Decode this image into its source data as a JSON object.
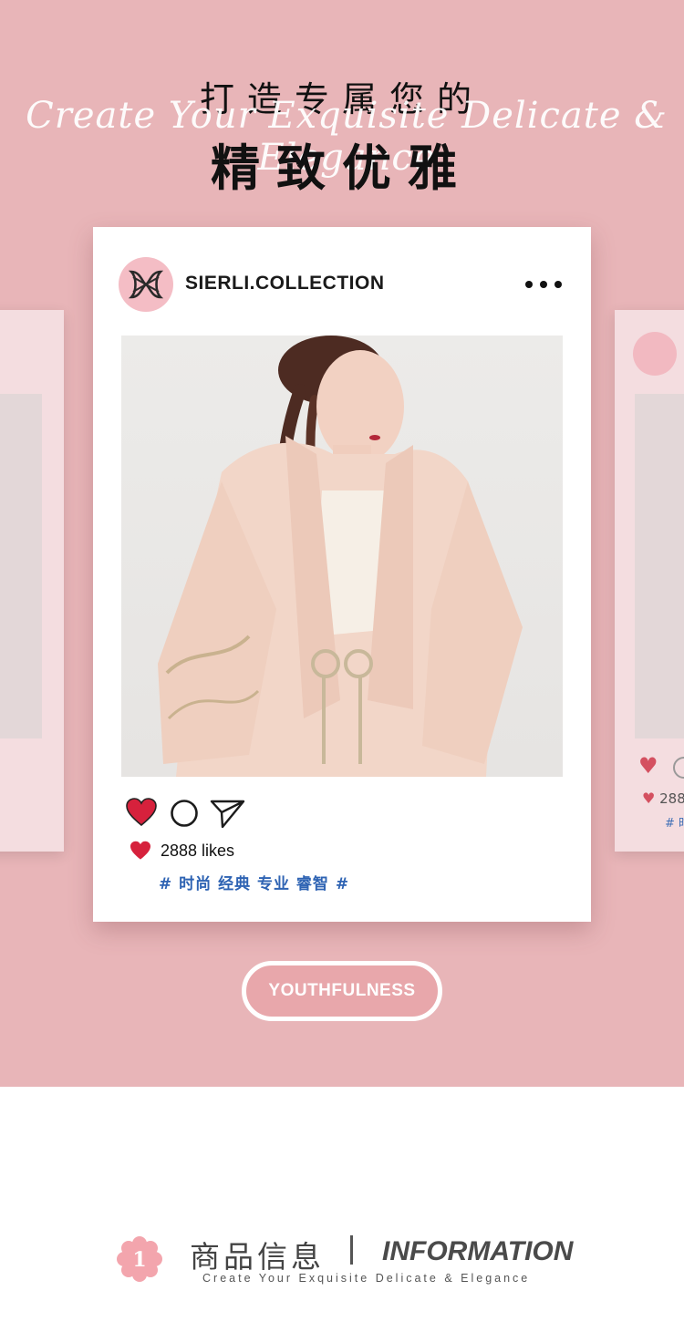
{
  "colors": {
    "background": "#e8b5b8",
    "card": "#ffffff",
    "heart": "#d6213c",
    "tag_text": "#2e63b3",
    "button": "#e8a7ab"
  },
  "header": {
    "title_small": "打造专属您的",
    "script_text": "Create Your Exquisite Delicate & Elegance",
    "title_big": "精致优雅"
  },
  "post": {
    "username": "SIERLI.COLLECTION",
    "avatar_icon": "brand-logo",
    "more_icon": "more-dots-icon",
    "photo_alt": "model wearing pink embroidered jacket",
    "actions": [
      "heart-icon",
      "comment-icon",
      "share-icon"
    ],
    "likes_text": "2888 likes",
    "tags": "# 时尚 经典 专业 睿智 #"
  },
  "side_cards": {
    "right_likes": "288",
    "right_tag": "# 时"
  },
  "button": {
    "label": "YOUTHFULNESS"
  },
  "info": {
    "badge_number": "1",
    "title_cn": "商品信息",
    "title_en": "INFORMATION",
    "subtitle": "Create Your Exquisite Delicate & Elegance"
  }
}
